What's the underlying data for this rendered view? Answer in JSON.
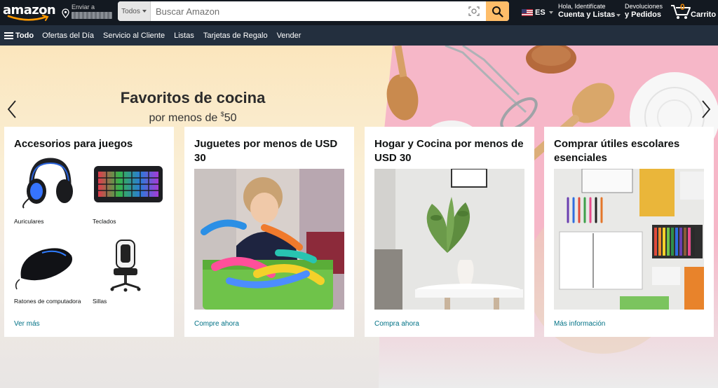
{
  "header": {
    "logo_text": "amazon",
    "deliver_line1": "Enviar a",
    "search": {
      "category": "Todos",
      "placeholder": "Buscar Amazon"
    },
    "language": "ES",
    "account_line1": "Hola, Identifícate",
    "account_line2": "Cuenta y Listas",
    "returns_line1": "Devoluciones",
    "returns_line2": "y Pedidos",
    "cart_count": "0",
    "cart_label": "Carrito"
  },
  "subnav": {
    "all_label": "Todo",
    "items": [
      "Ofertas del Día",
      "Servicio al Cliente",
      "Listas",
      "Tarjetas de Regalo",
      "Vender"
    ]
  },
  "hero": {
    "title": "Favoritos de cocina",
    "subtitle_prefix": "por menos de ",
    "currency": "$",
    "amount": "50"
  },
  "cards": [
    {
      "title": "Accesorios para juegos",
      "items": [
        "Auriculares",
        "Teclados",
        "Ratones de computadora",
        "Sillas"
      ],
      "link": "Ver más"
    },
    {
      "title": "Juguetes por menos de USD 30",
      "link": "Compre ahora"
    },
    {
      "title": "Hogar y Cocina por menos de USD 30",
      "link": "Compra ahora"
    },
    {
      "title": "Comprar útiles escolares esenciales",
      "link": "Más información"
    }
  ],
  "colors": {
    "nav_top": "#131921",
    "nav_sub": "#232f3e",
    "search_button": "#febd69",
    "cart_count": "#f08804",
    "link": "#007185",
    "hero_pink": "#f6b7c8"
  }
}
